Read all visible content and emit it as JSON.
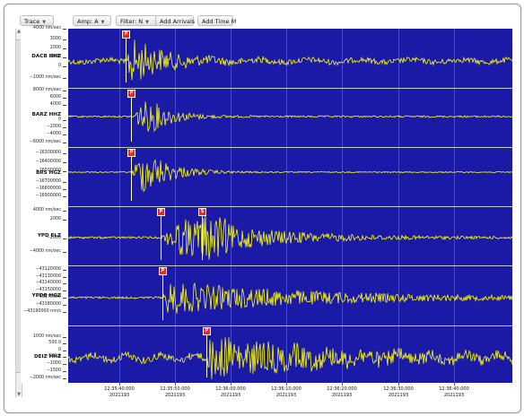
{
  "toolbar": {
    "trace": "Trace",
    "amp": "Amp: A",
    "filter": "Filter: N",
    "add_arrivals": "Add Arrivals",
    "add_time": "Add Time M"
  },
  "colors": {
    "plot_bg": "#1a1aa6",
    "trace": "#ffff00",
    "pick": "#e8282a"
  },
  "icons": {
    "dropdown": "chevron-down-icon"
  },
  "time_axis": [
    {
      "time": "12:35:40.000",
      "date": "2021193"
    },
    {
      "time": "12:35:50.000",
      "date": "2021193"
    },
    {
      "time": "12:36:00.000",
      "date": "2021193"
    },
    {
      "time": "12:36:10.000",
      "date": "2021193"
    },
    {
      "time": "12:36:20.000",
      "date": "2021193"
    },
    {
      "time": "12:36:30.000",
      "date": "2021193"
    },
    {
      "time": "12:36:40.000",
      "date": "2021193"
    }
  ],
  "channels": [
    {
      "station": "DACB HHZ",
      "ticks": [
        {
          "label": "4000 nm/sec",
          "v": 4000
        },
        {
          "label": "3000",
          "v": 3000
        },
        {
          "label": "2000",
          "v": 2000
        },
        {
          "label": "1000",
          "v": 1000
        },
        {
          "label": "0",
          "v": 0
        },
        {
          "label": "−1000 nm/sec",
          "v": -1000
        }
      ],
      "picks": [
        {
          "phase": "P"
        }
      ]
    },
    {
      "station": "BARZ HHZ",
      "ticks": [
        {
          "label": "8000 nm/sec",
          "v": 8000
        },
        {
          "label": "6000",
          "v": 6000
        },
        {
          "label": "4000",
          "v": 4000
        },
        {
          "label": "0",
          "v": 0
        },
        {
          "label": "−2000",
          "v": -2000
        },
        {
          "label": "−4000",
          "v": -4000
        },
        {
          "label": "−6000 nm/sec",
          "v": -6000
        }
      ],
      "picks": [
        {
          "phase": "P"
        }
      ]
    },
    {
      "station": "BRS HGZ",
      "ticks": [
        {
          "label": "−16300000",
          "v": -16300000
        },
        {
          "label": "−16400000",
          "v": -16400000
        },
        {
          "label": "−16500000",
          "v": -16500000
        },
        {
          "label": "−16700000",
          "v": -16700000
        },
        {
          "label": "−16800000",
          "v": -16800000
        },
        {
          "label": "−16900000",
          "v": -16900000
        }
      ],
      "picks": [
        {
          "phase": "P"
        }
      ]
    },
    {
      "station": "YPD ELZ",
      "ticks": [
        {
          "label": "4000 nm/sec",
          "v": 4000
        },
        {
          "label": "2000",
          "v": 2000
        },
        {
          "label": "−2000",
          "v": -2000
        },
        {
          "label": "−4000 nm/sec",
          "v": -4000
        }
      ],
      "picks": [
        {
          "phase": "P"
        },
        {
          "phase": "S"
        }
      ]
    },
    {
      "station": "YPDB HGZ",
      "ticks": [
        {
          "label": "−43120000",
          "v": -43120000
        },
        {
          "label": "−43130000",
          "v": -43130000
        },
        {
          "label": "−43140000",
          "v": -43140000
        },
        {
          "label": "−43150000",
          "v": -43150000
        },
        {
          "label": "−43170000",
          "v": -43170000
        },
        {
          "label": "−43180000",
          "v": -43180000
        },
        {
          "label": "−43190000 nm/s",
          "v": -43190000
        }
      ],
      "picks": [
        {
          "phase": "P"
        }
      ]
    },
    {
      "station": "DEIZ HHZ",
      "ticks": [
        {
          "label": "1000 nm/sec",
          "v": 1000
        },
        {
          "label": "500.0",
          "v": 500
        },
        {
          "label": "0",
          "v": 0
        },
        {
          "label": "−500.0",
          "v": -500
        },
        {
          "label": "−1000",
          "v": -1000
        },
        {
          "label": "−1500",
          "v": -1500
        },
        {
          "label": "−2000 nm/sec",
          "v": -2000
        }
      ],
      "picks": [
        {
          "phase": "P"
        }
      ]
    }
  ]
}
